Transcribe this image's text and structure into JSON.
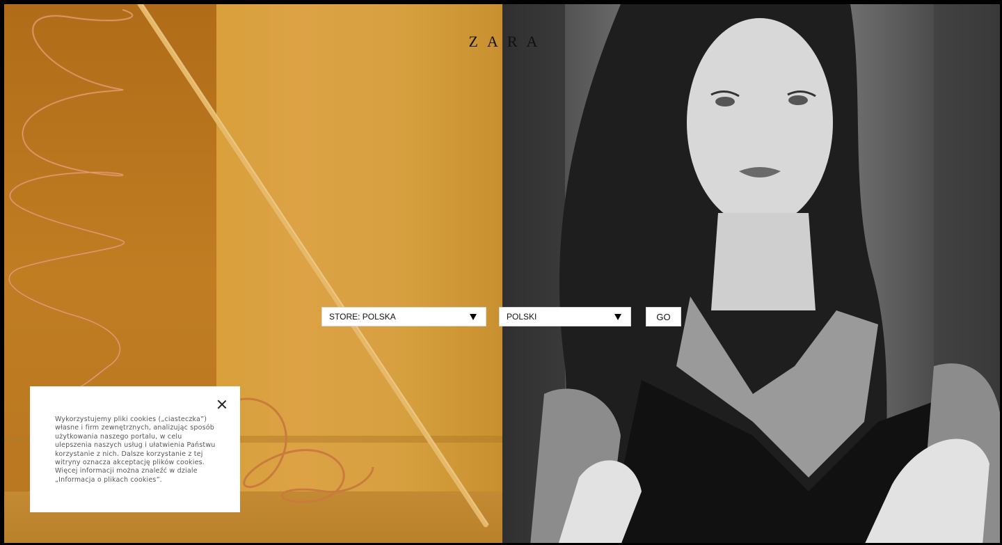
{
  "brand": {
    "logo_text": "ZARA"
  },
  "selector": {
    "store_value": "STORE: POLSKA",
    "language_value": "POLSKI",
    "go_label": "GO"
  },
  "cookie_notice": {
    "text": "Wykorzystujemy pliki cookies („ciasteczka”) własne i firm zewnętrznych, analizując sposób użytkowania naszego portalu, w celu ulepszenia naszych usług i ułatwienia Państwu korzystanie z nich. Dalsze korzystanie z tej witryny oznacza akceptację plików cookies. Więcej informacji można znaleźć w dziale „Informacja o plikach cookies”."
  },
  "icons": {
    "caret": "caret-down-icon",
    "close": "close-icon"
  },
  "colors": {
    "left_panel": "#d9a03c",
    "right_panel": "#6b6b6b",
    "text": "#111111"
  }
}
